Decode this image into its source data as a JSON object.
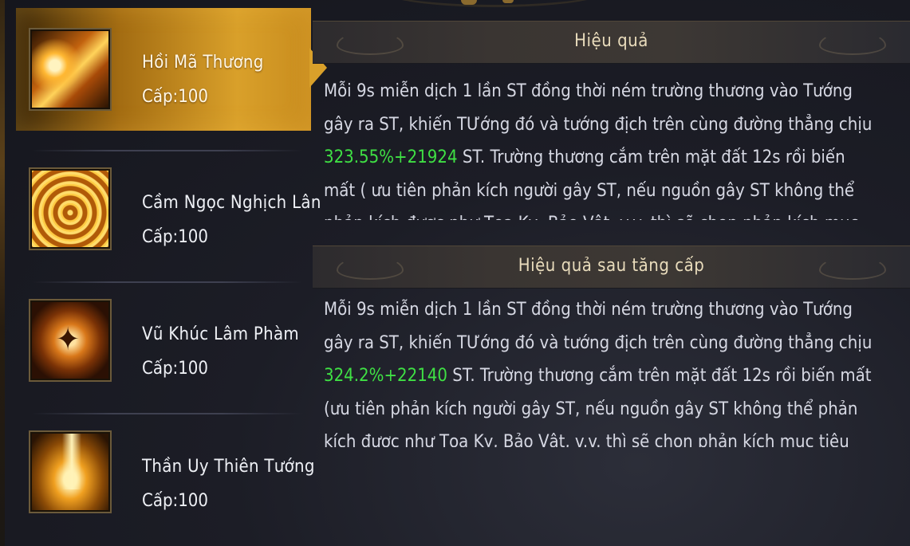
{
  "skills": [
    {
      "name": "Hồi Mã Thương",
      "level": "Cấp:100",
      "icon": "spear-strike-icon",
      "active": true
    },
    {
      "name": "Cầm Ngọc Nghịch Lân",
      "level": "Cấp:100",
      "icon": "golden-vortex-icon",
      "active": false
    },
    {
      "name": "Vũ Khúc Lâm Phàm",
      "level": "Cấp:100",
      "icon": "dancing-warrior-icon",
      "active": false
    },
    {
      "name": "Thần Uy Thiên Tướng",
      "level": "Cấp:100",
      "icon": "light-pillar-icon",
      "active": false
    }
  ],
  "effect": {
    "title": "Hiệu quả",
    "text_before": "Mỗi 9s miễn dịch 1 lần ST đồng thời ném trường thương vào Tướng gây ra ST, khiến TƯớng đó và tướng địch trên cùng đường thẳng chịu ",
    "highlight": "323.55%+21924",
    "text_after": " ST. Trường thương cắm trên mặt đất 12s  rồi biến mất ( ưu tiên phản kích người gây ST, nếu nguồn gây ST không thể phản kích được như  Tọa Kỵ, Bảo Vật, v.v. thì sẽ chọn phản kích mục tiêu địch"
  },
  "upgrade_effect": {
    "title": "Hiệu quả sau tăng cấp",
    "text_before": "Mỗi 9s miễn dịch 1 lần ST đồng thời ném trường thương vào Tướng gây ra ST, khiến TƯớng đó và tướng địch trên cùng đường thẳng chịu ",
    "highlight": "324.2%+22140",
    "text_after": " ST. Trường thương cắm trên mặt đất 12s  rồi biến mất (ưu tiên phản kích người gây ST, nếu nguồn gây ST không thể phản kích được như  Tọa Kỵ, Bảo Vật, v.v. thì sẽ chọn phản kích mục tiêu địch"
  },
  "colors": {
    "highlight": "#3fe044",
    "active_tab": "#d9a02a"
  }
}
